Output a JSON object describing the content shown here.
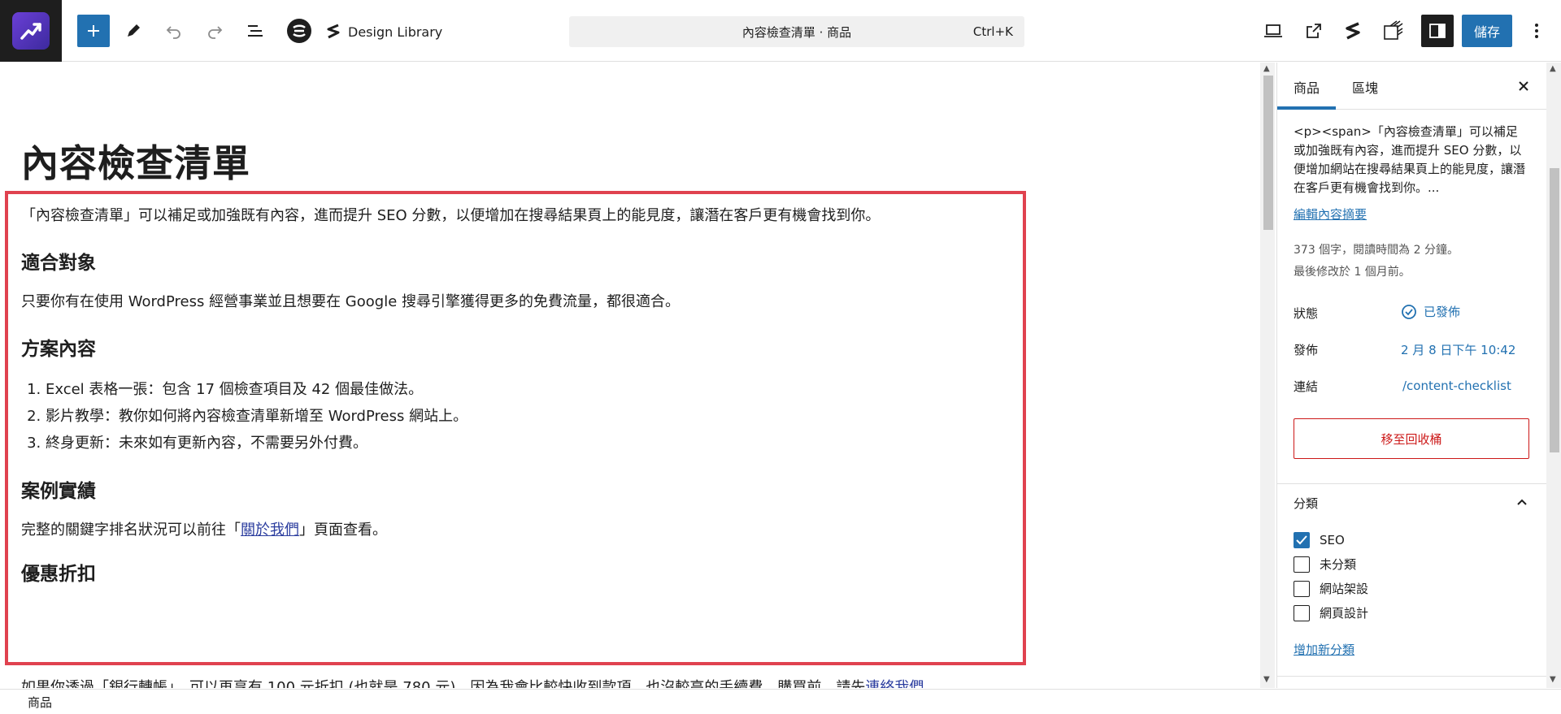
{
  "toolbar": {
    "design_library_label": "Design Library",
    "command_bar_text": "內容檢查清單 · 商品",
    "command_shortcut": "Ctrl+K",
    "save_label": "儲存"
  },
  "editor": {
    "title": "內容檢查清單",
    "intro": "「內容檢查清單」可以補足或加強既有內容，進而提升 SEO 分數，以便增加在搜尋結果頁上的能見度，讓潛在客戶更有機會找到你。",
    "h_audience": "適合對象",
    "audience_text": "只要你有在使用 WordPress 經營事業並且想要在 Google 搜尋引擎獲得更多的免費流量，都很適合。",
    "h_plan": "方案內容",
    "plan_items": [
      "Excel 表格一張：包含 17 個檢查項目及 42 個最佳做法。",
      "影片教學：教你如何將內容檢查清單新增至 WordPress 網站上。",
      "終身更新：未來如有更新內容，不需要另外付費。"
    ],
    "h_cases": "案例實績",
    "cases_text_before": "完整的關鍵字排名狀況可以前往「",
    "cases_link": "關於我們",
    "cases_text_after": "」頁面查看。",
    "h_discount": "優惠折扣",
    "discount_text": "如果你透過「銀行轉帳」，可以再享有 100 元折扣 (也就是 780 元)，因為我會比較快收到款項，也沒較高的手續費。購買前，請先",
    "discount_link": "連絡我們",
    "discount_end": "。"
  },
  "footer": {
    "breadcrumb": "商品"
  },
  "sidebar": {
    "tab_product": "商品",
    "tab_block": "區塊",
    "excerpt": "<p><span>「內容檢查清單」可以補足或加強既有內容，進而提升 SEO 分數，以便增加網站在搜尋結果頁上的能見度，讓潛在客戶更有機會找到你。...",
    "edit_excerpt": "編輯內容摘要",
    "meta_words": "373 個字，閱讀時間為 2 分鐘。",
    "meta_modified": "最後修改於 1 個月前。",
    "status_label": "狀態",
    "status_value": "已發佈",
    "publish_label": "發佈",
    "publish_value": "2 月 8 日下午 10:42",
    "link_label": "連結",
    "link_value": "/content-checklist",
    "trash_label": "移至回收桶",
    "categories_title": "分類",
    "categories": [
      {
        "label": "SEO",
        "checked": true
      },
      {
        "label": "未分類",
        "checked": false
      },
      {
        "label": "網站架設",
        "checked": false
      },
      {
        "label": "網頁設計",
        "checked": false
      }
    ],
    "add_category": "增加新分類"
  },
  "colors": {
    "accent": "#2271b1",
    "selection_border": "#e0424f",
    "danger": "#cc1818"
  }
}
